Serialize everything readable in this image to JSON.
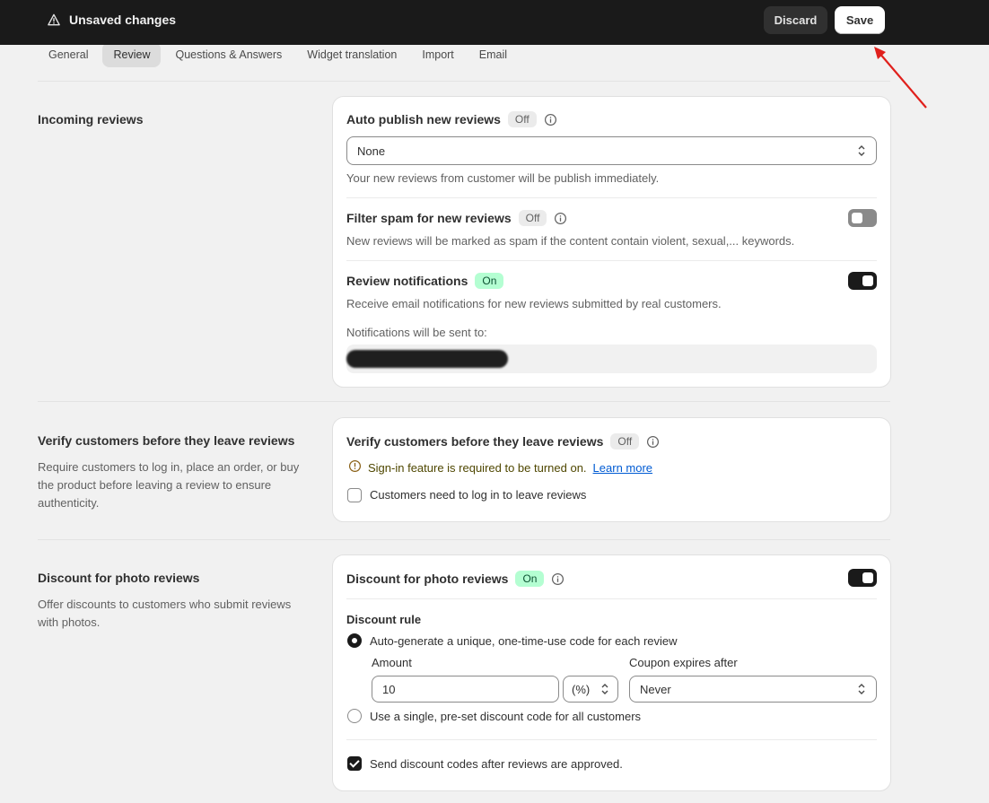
{
  "topbar": {
    "title": "Unsaved changes",
    "discard_label": "Discard",
    "save_label": "Save",
    "warning_icon": "warning-triangle-icon"
  },
  "tabs": [
    {
      "label": "General",
      "active": false
    },
    {
      "label": "Review",
      "active": true
    },
    {
      "label": "Questions & Answers",
      "active": false
    },
    {
      "label": "Widget translation",
      "active": false
    },
    {
      "label": "Import",
      "active": false
    },
    {
      "label": "Email",
      "active": false
    }
  ],
  "incoming": {
    "section_title": "Incoming reviews",
    "auto_publish": {
      "title": "Auto publish new reviews",
      "badge": "Off",
      "select_value": "None",
      "description": "Your new reviews from customer will be publish immediately."
    },
    "filter_spam": {
      "title": "Filter spam for new reviews",
      "badge": "Off",
      "description": "New reviews will be marked as spam if the content contain violent, sexual,... keywords.",
      "enabled": false
    },
    "notifications": {
      "title": "Review notifications",
      "badge": "On",
      "description": "Receive email notifications for new reviews submitted by real customers.",
      "sent_to_label": "Notifications will be sent to:",
      "enabled": true
    }
  },
  "verify": {
    "section_title": "Verify customers before they leave reviews",
    "section_desc": "Require customers to log in, place an order, or buy the product before leaving a review to ensure authenticity.",
    "card_title": "Verify customers before they leave reviews",
    "badge": "Off",
    "warning_text": "Sign-in feature is required to be turned on.",
    "learn_more": "Learn more",
    "checkbox_label": "Customers need to log in to leave reviews",
    "checked": false
  },
  "discount": {
    "section_title": "Discount for photo reviews",
    "section_desc": "Offer discounts to customers who submit reviews with photos.",
    "card_title": "Discount for photo reviews",
    "badge": "On",
    "enabled": true,
    "rule_label": "Discount rule",
    "option_auto": "Auto-generate a unique, one-time-use code for each review",
    "amount_label": "Amount",
    "amount_value": "10",
    "unit_value": "(%)",
    "expires_label": "Coupon expires after",
    "expires_value": "Never",
    "option_single": "Use a single, pre-set discount code for all customers",
    "send_codes_label": "Send discount codes after reviews are approved.",
    "send_codes_checked": true
  },
  "colors": {
    "topbar": "#1a1a1a",
    "badge_on_bg": "#b4fed2",
    "annotation_arrow": "#e0201c"
  }
}
